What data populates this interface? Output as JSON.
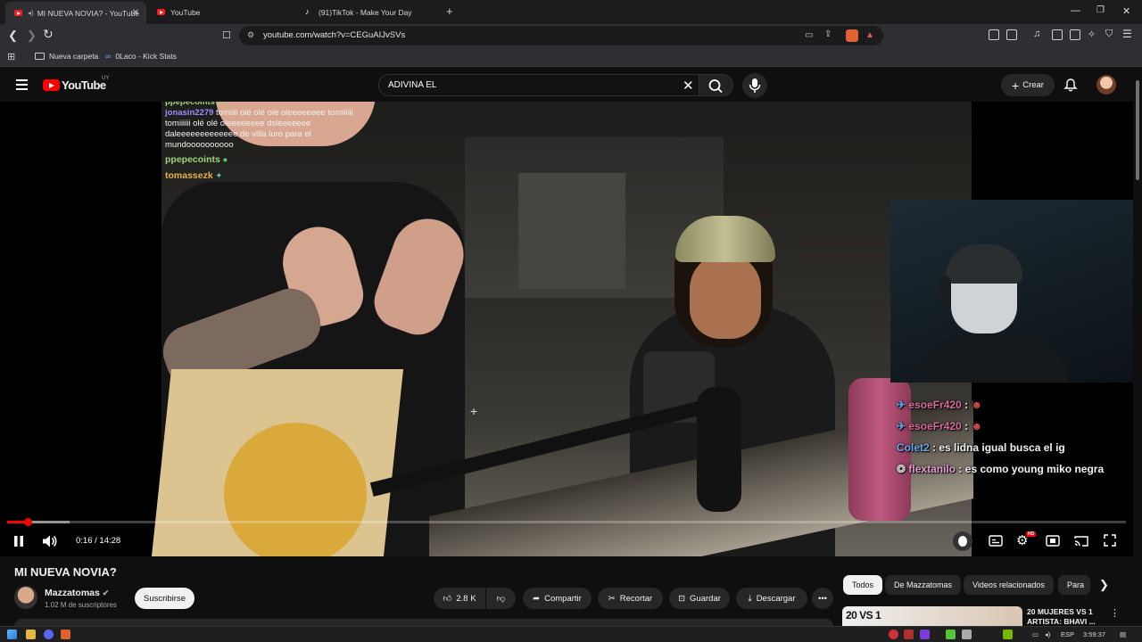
{
  "browser": {
    "tabs": [
      {
        "label": "MI NUEVA NOVIA? - YouTube",
        "active": true
      },
      {
        "label": "YouTube",
        "active": false
      },
      {
        "label": "(91)TikTok - Make Your Day",
        "active": false
      }
    ],
    "new_tab": "+",
    "url": "youtube.com/watch?v=CEGuAIJvSVs",
    "bookmarks": [
      {
        "label": "Nueva carpeta",
        "icon": "folder-icon"
      },
      {
        "label": "0Laco - Kick Stats",
        "icon": "kick-stats-icon"
      }
    ]
  },
  "youtube": {
    "logo_text": "YouTube",
    "country": "UY",
    "search_value": "ADIVINA EL",
    "create_label": "Crear"
  },
  "video": {
    "chat_top": [
      {
        "user": "ppepecoints",
        "user_color": "#9bd47a",
        "text": ""
      },
      {
        "user": "jonasin2279",
        "user_color": "#9e8cff",
        "text": "tomiiii olé olé olé oleeeeeeee tomiiiiii tomiiiiii olé olé oleeeeeeee dsleeeeeee daleeeeeeeeeeeee de villa luro para el mundoooooooooo"
      },
      {
        "user": "ppepecoints",
        "user_color": "#9bd47a",
        "text": ""
      },
      {
        "user": "tomassezk",
        "user_color": "#e8b04a",
        "text": ""
      }
    ],
    "chat_overlay": [
      {
        "user": "esoeFr420",
        "user_color": "#d86a9c",
        "text": ":"
      },
      {
        "user": "esoeFr420",
        "user_color": "#d86a9c",
        "text": ":"
      },
      {
        "user": "Colet2",
        "user_color": "#6aa6e8",
        "text": ": es lidna igual busca el ig"
      },
      {
        "user": "flextanilo",
        "user_color": "#e59ad0",
        "text": ": es como young miko negra"
      }
    ],
    "time_current": "0:16",
    "time_total": "14:28",
    "time_label": "0:16 / 14:28",
    "progress_played": 0.019,
    "progress_buffered": 0.056
  },
  "meta": {
    "title": "MI NUEVA NOVIA?",
    "channel": "Mazzatomas",
    "subscribers": "1.02 M de suscriptores",
    "subscribe_label": "Suscribirse",
    "like_count": "2.8 K",
    "share_label": "Compartir",
    "clip_label": "Recortar",
    "save_label": "Guardar",
    "download_label": "Descargar"
  },
  "chips": [
    {
      "label": "Todos",
      "selected": true
    },
    {
      "label": "De Mazzatomas",
      "selected": false
    },
    {
      "label": "Videos relacionados",
      "selected": false
    },
    {
      "label": "Para",
      "selected": false
    }
  ],
  "related": {
    "thumb_tag": "20 VS 1",
    "title": "20 MUJERES VS 1 ARTISTA: BHAVI ..."
  },
  "taskbar": {
    "language": "ESP",
    "time": "3:59:37"
  },
  "colors": {
    "accent": "#ff0000",
    "background": "#0f0f0f"
  }
}
